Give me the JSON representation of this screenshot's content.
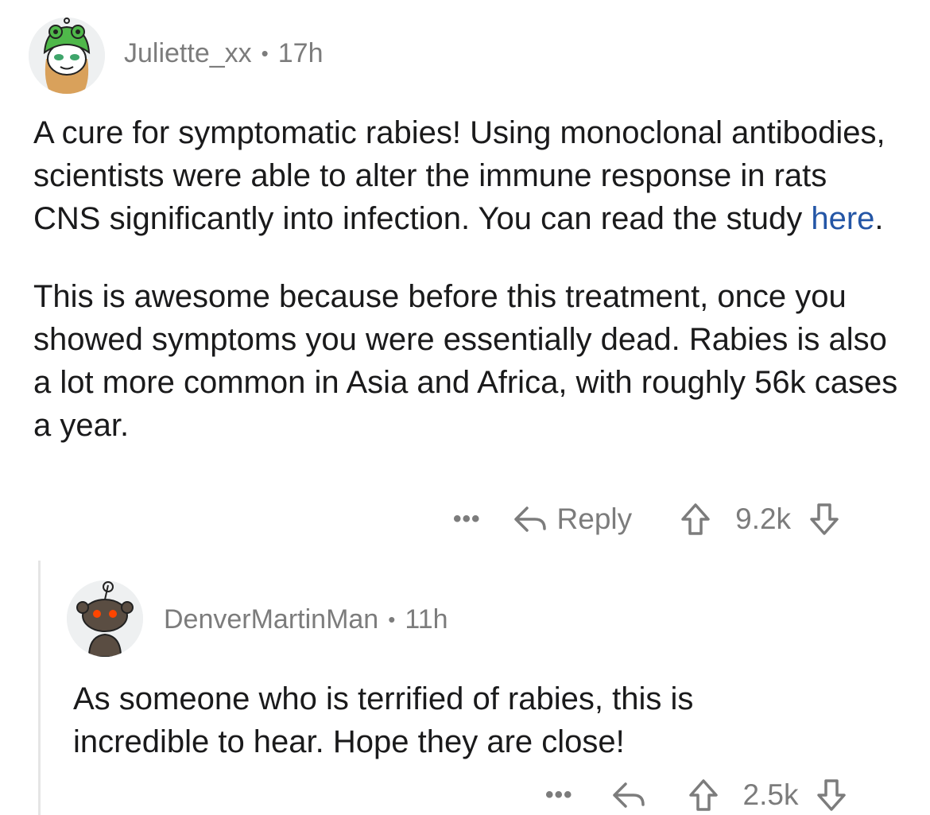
{
  "comments": [
    {
      "author": "Juliette_xx",
      "separator": "•",
      "age": "17h",
      "avatar_icon": "snoo-frog-hat-avatar",
      "paragraphs": [
        {
          "text_before_link": "A cure for symptomatic rabies! Using monoclonal antibodies, scientists were able to alter the immune response in rats CNS significantly into infection. You can read the study ",
          "link_text": "here",
          "text_after_link": "."
        },
        {
          "text": "This is awesome because before this treatment, once you showed symptoms you were essentially dead. Rabies is also a lot more common in Asia and Africa, with roughly 56k cases a year."
        }
      ],
      "actions": {
        "more": "•••",
        "reply_label": "Reply",
        "votes": "9.2k"
      }
    },
    {
      "author": "DenverMartinMan",
      "separator": "•",
      "age": "11h",
      "avatar_icon": "snoo-default-avatar",
      "paragraphs": [
        {
          "text": "As someone who is terrified of rabies, this is incredible to hear. Hope they are close!"
        }
      ],
      "actions": {
        "more": "•••",
        "votes": "2.5k"
      }
    }
  ],
  "colors": {
    "text": "#1a1a1b",
    "meta": "#7c7c7c",
    "link": "#2456a6",
    "thread_line": "#e5e5e5"
  }
}
